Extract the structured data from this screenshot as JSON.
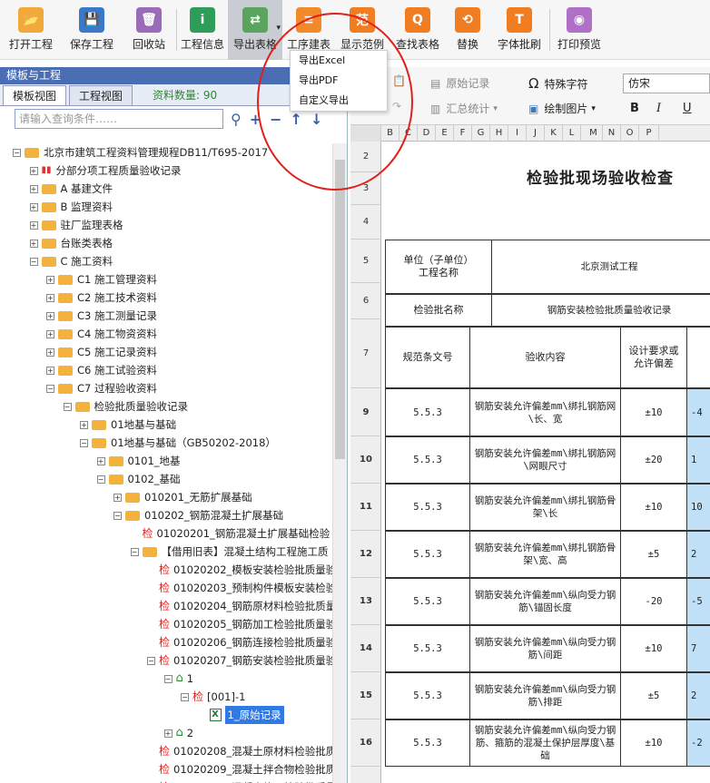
{
  "toolbar": {
    "buttons": [
      {
        "label": "打开工程",
        "color": "#f2a93b"
      },
      {
        "label": "保存工程",
        "color": "#3a78c8"
      },
      {
        "label": "回收站",
        "color": "#9a6bb8"
      },
      {
        "label": "工程信息",
        "color": "#2f9d5a"
      },
      {
        "label": "导出表格",
        "color": "#5aa55e"
      },
      {
        "label": "工序建表",
        "color": "#f08a2a"
      },
      {
        "label": "显示范例",
        "color": "#f07d22"
      },
      {
        "label": "查找表格",
        "color": "#f07d22"
      },
      {
        "label": "替换",
        "color": "#f07d22"
      },
      {
        "label": "字体批刷",
        "color": "#f07d22"
      },
      {
        "label": "打印预览",
        "color": "#b070c8"
      }
    ],
    "dropdown_items": [
      "导出Excel",
      "导出PDF",
      "自定义导出"
    ]
  },
  "left_panel": {
    "title": "模板与工程",
    "tabs": [
      "模板视图",
      "工程视图"
    ],
    "count_label": "资料数量: 90",
    "search_placeholder": "请输入查询条件……"
  },
  "tree": [
    {
      "text": "北京市建筑工程资料管理规程DB11/T695-2017",
      "level": 0,
      "kind": "folder",
      "toggle": "−"
    },
    {
      "text": "分部分项工程质量验收记录",
      "level": 1,
      "kind": "chart",
      "toggle": "+"
    },
    {
      "text": "A 基建文件",
      "level": 1,
      "kind": "folder",
      "toggle": "+"
    },
    {
      "text": "B 监理资料",
      "level": 1,
      "kind": "folder",
      "toggle": "+"
    },
    {
      "text": "驻厂监理表格",
      "level": 1,
      "kind": "folder",
      "toggle": "+"
    },
    {
      "text": "台账类表格",
      "level": 1,
      "kind": "folder",
      "toggle": "+"
    },
    {
      "text": "C 施工资料",
      "level": 1,
      "kind": "folder",
      "toggle": "−"
    },
    {
      "text": "C1 施工管理资料",
      "level": 2,
      "kind": "folder",
      "toggle": "+"
    },
    {
      "text": "C2 施工技术资料",
      "level": 2,
      "kind": "folder",
      "toggle": "+"
    },
    {
      "text": "C3 施工测量记录",
      "level": 2,
      "kind": "folder",
      "toggle": "+"
    },
    {
      "text": "C4 施工物资资料",
      "level": 2,
      "kind": "folder",
      "toggle": "+"
    },
    {
      "text": "C5 施工记录资料",
      "level": 2,
      "kind": "folder",
      "toggle": "+"
    },
    {
      "text": "C6 施工试验资料",
      "level": 2,
      "kind": "folder",
      "toggle": "+"
    },
    {
      "text": "C7 过程验收资料",
      "level": 2,
      "kind": "folder",
      "toggle": "−"
    },
    {
      "text": "检验批质量验收记录",
      "level": 3,
      "kind": "folder",
      "toggle": "−"
    },
    {
      "text": "01地基与基础",
      "level": 4,
      "kind": "folder",
      "toggle": "+"
    },
    {
      "text": "01地基与基础（GB50202-2018）",
      "level": 4,
      "kind": "folder",
      "toggle": "−"
    },
    {
      "text": "0101_地基",
      "level": 5,
      "kind": "folder",
      "toggle": "+"
    },
    {
      "text": "0102_基础",
      "level": 5,
      "kind": "folder",
      "toggle": "−"
    },
    {
      "text": "010201_无筋扩展基础",
      "level": 6,
      "kind": "folder",
      "toggle": "+"
    },
    {
      "text": "010202_钢筋混凝土扩展基础",
      "level": 6,
      "kind": "folder",
      "toggle": "−"
    },
    {
      "text": "01020201_钢筋混凝土扩展基础检验",
      "level": 7,
      "kind": "check",
      "toggle": ""
    },
    {
      "text": "【借用旧表】混凝土结构工程施工质",
      "level": 7,
      "kind": "folder",
      "toggle": "−"
    },
    {
      "text": "01020202_模板安装检验批质量验",
      "level": 8,
      "kind": "check",
      "toggle": ""
    },
    {
      "text": "01020203_预制构件模板安装检验",
      "level": 8,
      "kind": "check",
      "toggle": ""
    },
    {
      "text": "01020204_钢筋原材料检验批质量",
      "level": 8,
      "kind": "check",
      "toggle": ""
    },
    {
      "text": "01020205_钢筋加工检验批质量验",
      "level": 8,
      "kind": "check",
      "toggle": ""
    },
    {
      "text": "01020206_钢筋连接检验批质量验",
      "level": 8,
      "kind": "check",
      "toggle": ""
    },
    {
      "text": "01020207_钢筋安装检验批质量验",
      "level": 8,
      "kind": "check",
      "toggle": "−"
    },
    {
      "text": "1",
      "level": 9,
      "kind": "home",
      "toggle": "−"
    },
    {
      "text": "[001]-1",
      "level": 10,
      "kind": "check",
      "toggle": "−"
    },
    {
      "text": "1_原始记录",
      "level": 11,
      "kind": "excel",
      "toggle": "",
      "selected": true
    },
    {
      "text": "2",
      "level": 9,
      "kind": "home",
      "toggle": "+"
    },
    {
      "text": "01020208_混凝土原材料检验批质",
      "level": 8,
      "kind": "check",
      "toggle": ""
    },
    {
      "text": "01020209_混凝土拌合物检验批质",
      "level": 8,
      "kind": "check",
      "toggle": ""
    },
    {
      "text": "01020210_混凝土施工检验批质量",
      "level": 8,
      "kind": "check",
      "toggle": ""
    }
  ],
  "ribbon": {
    "raw_record": "原始记录",
    "summary": "汇总统计",
    "special_char": "特殊字符",
    "draw_image": "绘制图片",
    "font": "仿宋",
    "bold": "B",
    "italic": "I",
    "underline": "U"
  },
  "columns": [
    "B",
    "C",
    "D",
    "E",
    "F",
    "G",
    "H",
    "I",
    "J",
    "K",
    "L",
    "M",
    "N",
    "O",
    "P"
  ],
  "rows": [
    "2",
    "3",
    "4",
    "5",
    "6",
    "7",
    "9",
    "10",
    "11",
    "12",
    "13",
    "14",
    "15",
    "16"
  ],
  "sheet": {
    "title": "检验批现场验收检查",
    "unit_label": "单位（子单位）\n工程名称",
    "unit_value": "北京测试工程",
    "batch_label": "检验批名称",
    "batch_value": "钢筋安装检验批质量验收记录",
    "col_spec": "规范条文号",
    "col_content": "验收内容",
    "col_design": "设计要求或\n允许偏差",
    "data_rows": [
      {
        "spec": "5.5.3",
        "content": "钢筋安装允许偏差mm\\绑扎钢筋网\\长、宽",
        "design": "±10",
        "value": "-4"
      },
      {
        "spec": "5.5.3",
        "content": "钢筋安装允许偏差mm\\绑扎钢筋网\\网眼尺寸",
        "design": "±20",
        "value": "1"
      },
      {
        "spec": "5.5.3",
        "content": "钢筋安装允许偏差mm\\绑扎钢筋骨架\\长",
        "design": "±10",
        "value": "10"
      },
      {
        "spec": "5.5.3",
        "content": "钢筋安装允许偏差mm\\绑扎钢筋骨架\\宽、高",
        "design": "±5",
        "value": "2"
      },
      {
        "spec": "5.5.3",
        "content": "钢筋安装允许偏差mm\\纵向受力钢筋\\锚固长度",
        "design": "-20",
        "value": "-5"
      },
      {
        "spec": "5.5.3",
        "content": "钢筋安装允许偏差mm\\纵向受力钢筋\\间距",
        "design": "±10",
        "value": "7"
      },
      {
        "spec": "5.5.3",
        "content": "钢筋安装允许偏差mm\\纵向受力钢筋\\排距",
        "design": "±5",
        "value": "2"
      },
      {
        "spec": "5.5.3",
        "content": "钢筋安装允许偏差mm\\纵向受力钢筋、箍筋的混凝土保护层厚度\\基础",
        "design": "±10",
        "value": "-2"
      }
    ]
  }
}
